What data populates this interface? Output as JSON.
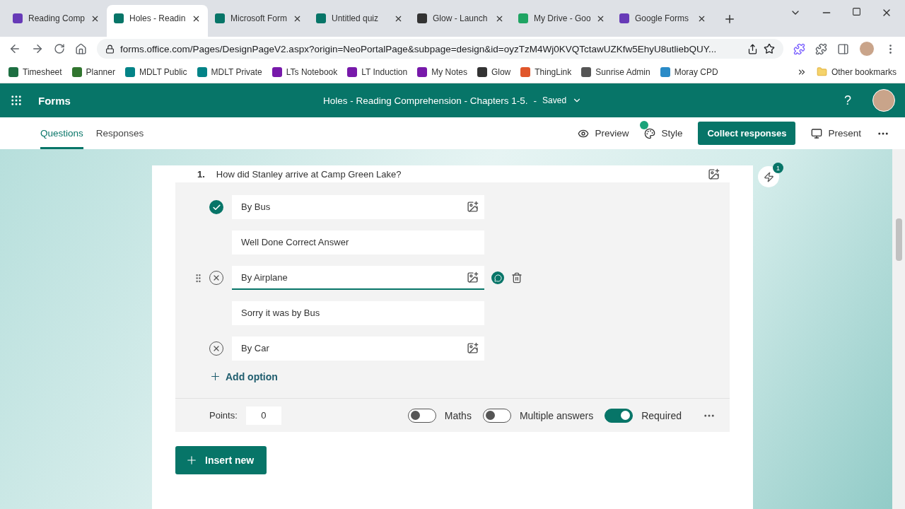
{
  "browser": {
    "tabs": [
      {
        "title": "Reading Comp",
        "selected": false,
        "color": "#673ab7"
      },
      {
        "title": "Holes - Readin",
        "selected": true,
        "color": "#077568"
      },
      {
        "title": "Microsoft Form",
        "selected": false,
        "color": "#077568"
      },
      {
        "title": "Untitled quiz",
        "selected": false,
        "color": "#077568"
      },
      {
        "title": "Glow - Launch",
        "selected": false,
        "color": "#333333"
      },
      {
        "title": "My Drive - Goo",
        "selected": false,
        "color": "#1fa463"
      },
      {
        "title": "Google Forms",
        "selected": false,
        "color": "#673ab7"
      }
    ],
    "url": "forms.office.com/Pages/DesignPageV2.aspx?origin=NeoPortalPage&subpage=design&id=oyzTzM4Wj0KVQTctawUZKfw5EhyU8utliebQUY...",
    "bookmarks": [
      {
        "label": "Timesheet",
        "color": "#1d6f42"
      },
      {
        "label": "Planner",
        "color": "#31752f"
      },
      {
        "label": "MDLT Public",
        "color": "#038387"
      },
      {
        "label": "MDLT Private",
        "color": "#038387"
      },
      {
        "label": "LTs Notebook",
        "color": "#7719aa"
      },
      {
        "label": "LT Induction",
        "color": "#7719aa"
      },
      {
        "label": "My Notes",
        "color": "#7719aa"
      },
      {
        "label": "Glow",
        "color": "#333333"
      },
      {
        "label": "ThingLink",
        "color": "#e0562b"
      },
      {
        "label": "Sunrise Admin",
        "color": "#555555"
      },
      {
        "label": "Moray CPD",
        "color": "#2a8bc7"
      }
    ],
    "other_bookmarks": "Other bookmarks"
  },
  "app": {
    "name": "Forms",
    "form_title": "Holes - Reading Comprehension - Chapters 1-5.",
    "separator": "-",
    "save_status": "Saved",
    "help": "?"
  },
  "nav": {
    "tabs": [
      {
        "label": "Questions",
        "selected": true
      },
      {
        "label": "Responses",
        "selected": false
      }
    ],
    "preview": "Preview",
    "style": "Style",
    "collect": "Collect responses",
    "present": "Present"
  },
  "question": {
    "number": "1.",
    "text": "How did Stanley arrive at Camp Green Lake?",
    "items": [
      {
        "kind": "option",
        "text": "By Bus",
        "correct": true,
        "focused": false
      },
      {
        "kind": "feedback",
        "text": "Well Done Correct Answer"
      },
      {
        "kind": "option",
        "text": "By Airplane",
        "correct": false,
        "focused": true
      },
      {
        "kind": "feedback",
        "text": "Sorry it was by Bus"
      },
      {
        "kind": "option",
        "text": "By Car",
        "correct": false,
        "focused": false
      }
    ],
    "add_option": "Add option",
    "points_label": "Points:",
    "points": "0",
    "toggles": [
      {
        "label": "Maths",
        "on": false
      },
      {
        "label": "Multiple answers",
        "on": false
      },
      {
        "label": "Required",
        "on": true
      }
    ]
  },
  "insert_new": "Insert new",
  "ideas_badge": "1"
}
